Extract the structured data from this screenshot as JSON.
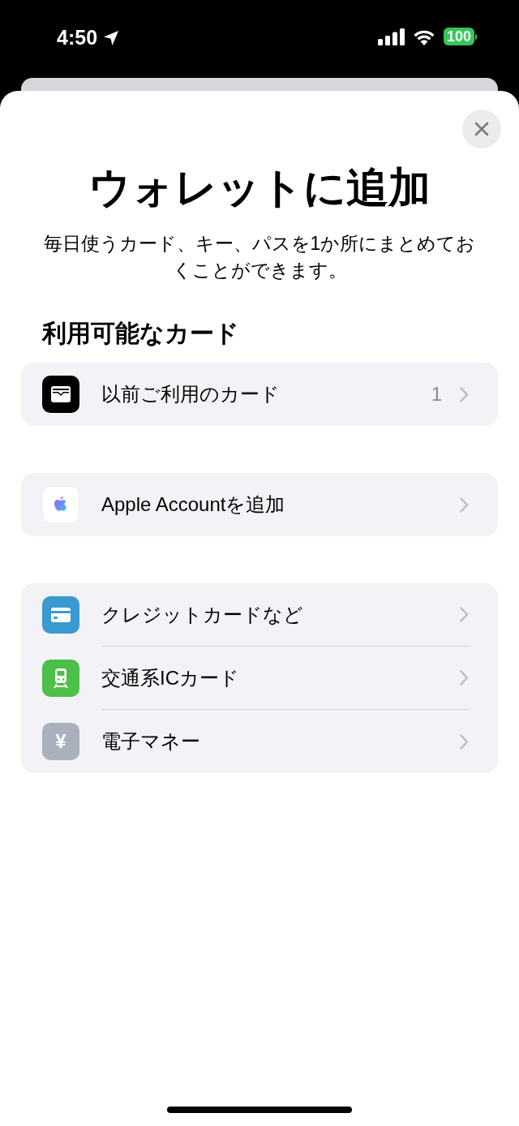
{
  "status_bar": {
    "time": "4:50",
    "battery": "100"
  },
  "title": "ウォレットに追加",
  "subtitle": "毎日使うカード、キー、パスを1か所にまとめておくことができます。",
  "section_title": "利用可能なカード",
  "groups": [
    {
      "rows": [
        {
          "kind": "wallet",
          "color": "#000000",
          "label": "以前ご利用のカード",
          "count": "1"
        }
      ]
    },
    {
      "rows": [
        {
          "kind": "apple",
          "color": "#ffffff",
          "label": "Apple Accountを追加"
        }
      ]
    },
    {
      "rows": [
        {
          "kind": "card",
          "color": "#3a9ad0",
          "label": "クレジットカードなど"
        },
        {
          "kind": "train",
          "color": "#4cc048",
          "label": "交通系ICカード"
        },
        {
          "kind": "yen",
          "color": "#aab1bc",
          "label": "電子マネー",
          "glyph": "¥"
        }
      ]
    }
  ]
}
